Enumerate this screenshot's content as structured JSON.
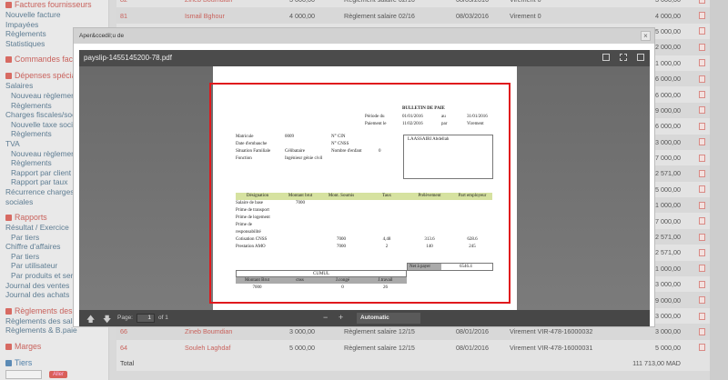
{
  "sidebar": {
    "factures": "Factures fournisseurs",
    "nouvelle_facture": "Nouvelle facture",
    "impayees": "Impayées",
    "reglements": "Règlements",
    "statistiques": "Statistiques",
    "commandes": "Commandes facturées",
    "depenses": "Dépenses spéciales",
    "salaires": "Salaires",
    "nouveau_reglement": "Nouveau règlement",
    "charges": "Charges fiscales/sociales",
    "nouvelle_taxe": "Nouvelle taxe sociale",
    "tva": "TVA",
    "rapport_client": "Rapport par client",
    "rapport_taux": "Rapport par taux",
    "recurrence": "Récurrence charges",
    "sociales": "sociales",
    "rapports": "Rapports",
    "resultat": "Résultat / Exercice",
    "par_tiers": "Par tiers",
    "chiffre": "Chiffre d'affaires",
    "par_utilisateur": "Par utilisateur",
    "par_produits": "Par produits et services",
    "journal_ventes": "Journal des ventes",
    "journal_achats": "Journal des achats",
    "reglements_salaires": "Règlements des salaires",
    "reglements_sala": "Règlements des salaires",
    "reglements_bpaie": "Règlements & B.paie",
    "marges": "Marges",
    "tiers": "Tiers",
    "aller": "Aller"
  },
  "table": {
    "rows": [
      {
        "ref": "82",
        "tier": "Zineb Boumdian",
        "amount": "3 000,00",
        "label": "Règlement salaire 02/16",
        "date": "08/03/2016",
        "mode": "Virement 0",
        "total": "3 000,00"
      },
      {
        "ref": "81",
        "tier": "Ismail Bghour",
        "amount": "4 000,00",
        "label": "Règlement salaire 02/16",
        "date": "08/03/2016",
        "mode": "Virement 0",
        "total": "4 000,00"
      },
      {
        "total": "5 000,00"
      },
      {
        "total": "2 000,00"
      },
      {
        "total": "1 000,00"
      },
      {
        "total": "6 000,00"
      },
      {
        "total": "6 000,00"
      },
      {
        "total": "9 000,00"
      },
      {
        "total": "6 000,00"
      },
      {
        "total": "3 000,00"
      },
      {
        "total": "7 000,00",
        "zoom": true
      },
      {
        "total": "2 571,00"
      },
      {
        "total": "5 000,00"
      },
      {
        "total": "1 000,00"
      },
      {
        "total": "7 000,00"
      },
      {
        "total": "2 571,00"
      },
      {
        "total": "2 571,00"
      },
      {
        "total": "1 000,00"
      },
      {
        "total": "3 000,00"
      },
      {
        "total": "9 000,00",
        "zoom": true
      },
      {
        "total": "3 000,00"
      },
      {
        "ref": "66",
        "tier": "Zineb Boumdian",
        "amount": "3 000,00",
        "label": "Règlement salaire 12/15",
        "date": "08/01/2016",
        "mode": "Virement VIR-478-16000032",
        "total": "3 000,00"
      },
      {
        "ref": "64",
        "tier": "Souleh Laghdaf",
        "amount": "5 000,00",
        "label": "Règlement salaire 12/15",
        "date": "08/01/2016",
        "mode": "Virement VIR-478-16000031",
        "total": "5 000,00"
      }
    ],
    "total_label": "Total",
    "grand_total": "111 713,00 MAD"
  },
  "modal": {
    "title": "Aper&ccedil;u de",
    "close": "×"
  },
  "viewer": {
    "filename": "payslip-1455145200-78.pdf",
    "page_label": "Page:",
    "page": "1",
    "of": "of 1",
    "zoom": "Automatic",
    "minus": "−",
    "plus": "+"
  },
  "payslip": {
    "title": "BULLETIN DE PAIE",
    "periode": "Période du",
    "from": "01/01/2016",
    "au": "au",
    "to": "31/01/2016",
    "paiement": "Paiement le",
    "pay_date": "11/02/2016",
    "par": "par",
    "mode": "Virement",
    "matricule_l": "Matricule",
    "matricule": "0009",
    "embauche_l": "Date d'embauche",
    "situation_l": "Situation Familiale",
    "situation": "Célibataire",
    "fonction_l": "Fonction",
    "fonction": "Ingénieur génie civil",
    "cin_l": "N° CIN",
    "cnss_l": "N° CNSS",
    "enfants_l": "Nombre d'enfant",
    "enfants": "0",
    "employee": "LAASSAIRI Abdellah",
    "headers": [
      "Désignation",
      "Montant brut",
      "Mont. Soumis",
      "Taux",
      "Prélèvement",
      "Part employeur"
    ],
    "lines": [
      [
        "Salaire de base",
        "7000",
        "",
        "",
        "",
        ""
      ],
      [
        "Prime de transport",
        "",
        "",
        "",
        "",
        ""
      ],
      [
        "Prime de logement",
        "",
        "",
        "",
        "",
        ""
      ],
      [
        "Prime de",
        "",
        "",
        "",
        "",
        ""
      ],
      [
        "responsabilité",
        "",
        "",
        "",
        "",
        ""
      ],
      [
        "Cotisation CNSS",
        "",
        "7000",
        "4,48",
        "313.6",
        "628.6"
      ],
      [
        "Prestation AMO",
        "",
        "7000",
        "2",
        "140",
        "245"
      ]
    ],
    "net_l": "Net à payer",
    "net": "6546.4",
    "cumul": "CUMUL",
    "cumul_headers": [
      "Montant Brut",
      "cnss",
      "J.congé",
      "J.travail"
    ],
    "cumul_values": [
      "7000",
      "",
      "0",
      "26"
    ]
  }
}
